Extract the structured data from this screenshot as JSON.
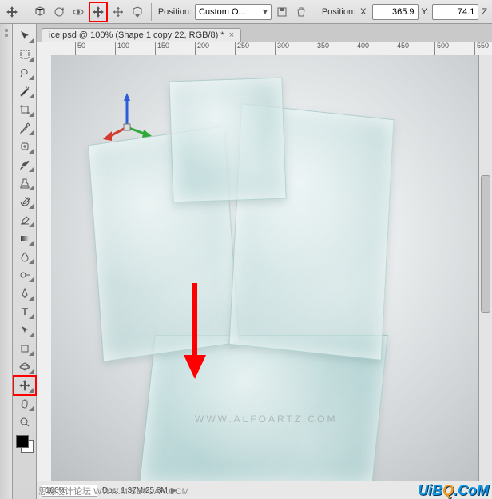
{
  "toolbar": {
    "position_label": "Position:",
    "position_dropdown": "Custom O...",
    "pos2_label": "Position:",
    "x_label": "X:",
    "x_value": "365.9",
    "y_label": "Y:",
    "y_value": "74.1",
    "z_label": "Z"
  },
  "doc_tab": {
    "title": "ice.psd @ 100% (Shape 1 copy 22, RGB/8) *"
  },
  "ruler_ticks": [
    "50",
    "100",
    "150",
    "200",
    "250",
    "300",
    "350",
    "400",
    "450",
    "500",
    "550"
  ],
  "status": {
    "zoom": "100%",
    "doc_label": "Doc:",
    "doc_value": "1.37M/25.8M"
  },
  "watermark": "WWW.ALFOARTZ.COM",
  "brand_pre": "UiB",
  "brand_mid": "Q",
  "brand_suf": ".CoM",
  "cn_text1": "思缘设计论坛",
  "cn_text2": "WWW.MISSYUAN.COM"
}
